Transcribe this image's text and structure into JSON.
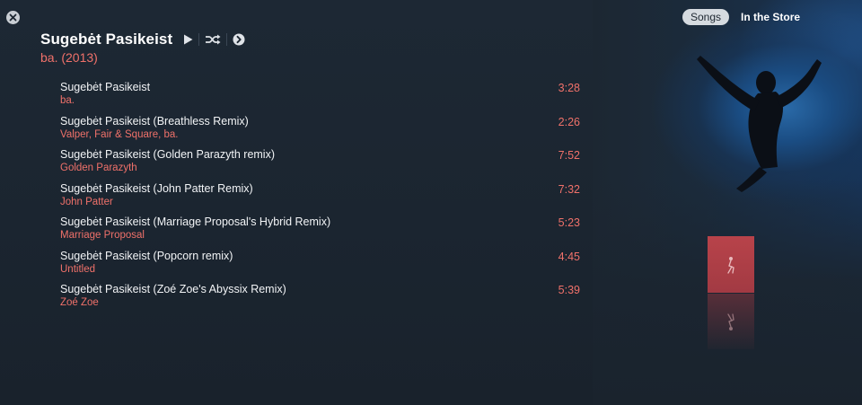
{
  "window": {
    "close_icon": "close-icon"
  },
  "album": {
    "title": "Sugebėt Pasikeist",
    "subtitle": "ba. (2013)"
  },
  "controls": {
    "play_icon": "play-icon",
    "shuffle_icon": "shuffle-icon",
    "more_icon": "arrow-circle-icon"
  },
  "tabs": {
    "songs": "Songs",
    "store": "In the Store"
  },
  "tracks": [
    {
      "title": "Sugebėt Pasikeist",
      "artist": "ba.",
      "time": "3:28"
    },
    {
      "title": "Sugebėt Pasikeist (Breathless Remix)",
      "artist": "Valper, Fair & Square, ba.",
      "time": "2:26"
    },
    {
      "title": "Sugebėt Pasikeist (Golden Parazyth remix)",
      "artist": "Golden Parazyth",
      "time": "7:52"
    },
    {
      "title": "Sugebėt Pasikeist (John Patter Remix)",
      "artist": "John Patter",
      "time": "7:32"
    },
    {
      "title": "Sugebėt Pasikeist (Marriage Proposal's Hybrid Remix)",
      "artist": "Marriage Proposal",
      "time": "5:23"
    },
    {
      "title": "Sugebėt Pasikeist (Popcorn remix)",
      "artist": "Untitled",
      "time": "4:45"
    },
    {
      "title": "Sugebėt Pasikeist (Zoé Zoe's Abyssix Remix)",
      "artist": "Zoé Zoe",
      "time": "5:39"
    }
  ],
  "colors": {
    "background": "#1c2631",
    "accent": "#f0716a",
    "text": "#f2f4f6",
    "cover_red": "#a23a43"
  }
}
